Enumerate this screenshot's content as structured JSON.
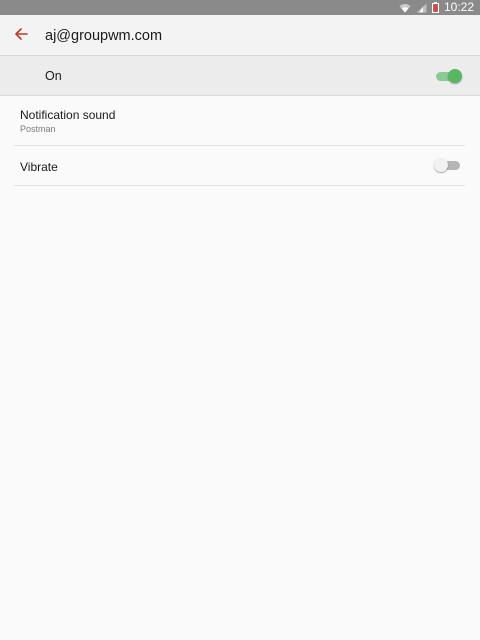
{
  "status_bar": {
    "time": "10:22",
    "icons": [
      "wifi-icon",
      "signal-icon",
      "battery-low-icon"
    ],
    "background_color": "#8a8a8a"
  },
  "app_bar": {
    "title": "aj@groupwm.com",
    "back_icon": "arrow-back-icon",
    "accent_color": "#c0392b"
  },
  "master_switch": {
    "label": "On",
    "state": true,
    "on_color": "#57b861"
  },
  "settings": {
    "notification_sound": {
      "title": "Notification sound",
      "value": "Postman"
    },
    "vibrate": {
      "title": "Vibrate",
      "state": false
    }
  }
}
